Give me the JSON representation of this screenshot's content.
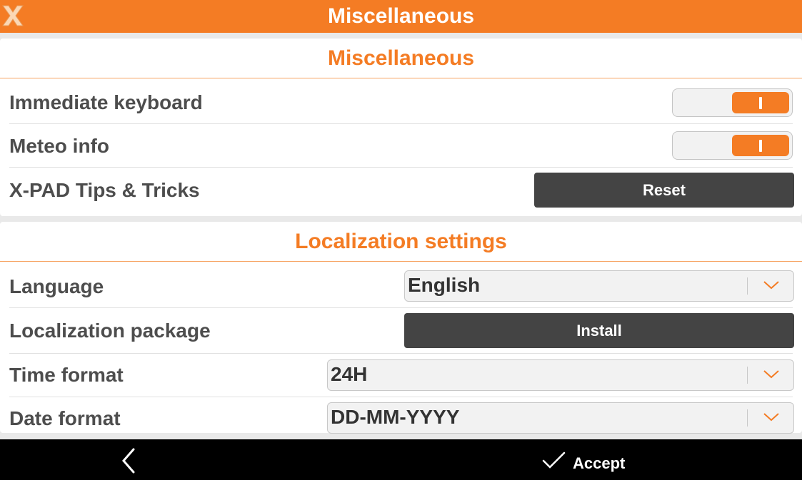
{
  "app": {
    "title": "Miscellaneous",
    "accent_color": "#f47c24",
    "logo_icon": "x-pad-logo-icon"
  },
  "misc_section": {
    "header": "Miscellaneous",
    "immediate_keyboard": {
      "label": "Immediate keyboard",
      "enabled": true
    },
    "meteo_info": {
      "label": "Meteo info",
      "enabled": true
    },
    "tips": {
      "label": "X-PAD Tips & Tricks",
      "button_label": "Reset"
    }
  },
  "localization_section": {
    "header": "Localization settings",
    "language": {
      "label": "Language",
      "value": "English"
    },
    "package": {
      "label": "Localization package",
      "button_label": "Install"
    },
    "time_format": {
      "label": "Time format",
      "value": "24H"
    },
    "date_format": {
      "label": "Date format",
      "value": "DD-MM-YYYY"
    }
  },
  "bottom_bar": {
    "back_icon": "chevron-left-icon",
    "accept_icon": "checkmark-icon",
    "accept_label": "Accept"
  }
}
